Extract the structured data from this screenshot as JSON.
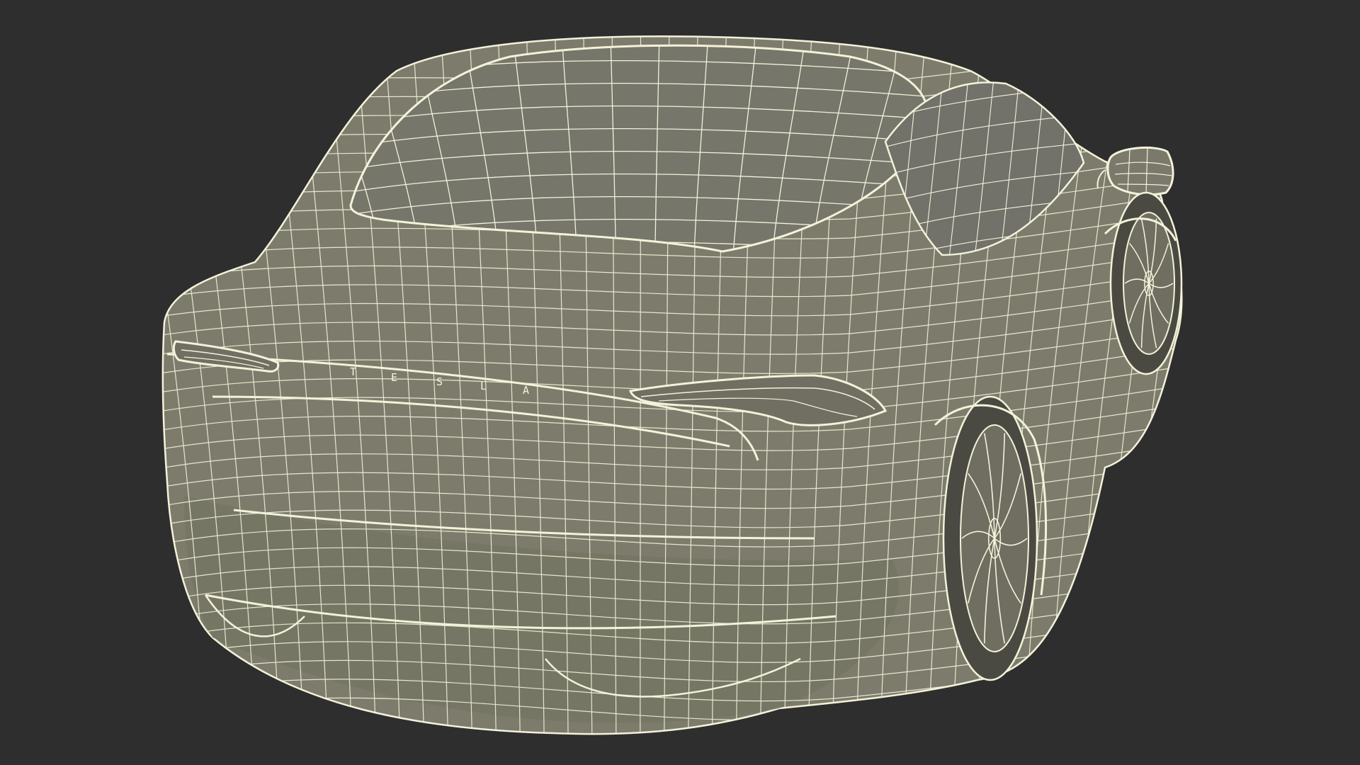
{
  "render": {
    "background_color": "#2e2e2e",
    "body_color": "#7d7c6c",
    "body_shade_color": "#6b6a5c",
    "wire_color": "#f3f2da",
    "glass_color": "#77766a"
  },
  "emblem": {
    "letters": [
      "T",
      "E",
      "S",
      "L",
      "A"
    ]
  }
}
